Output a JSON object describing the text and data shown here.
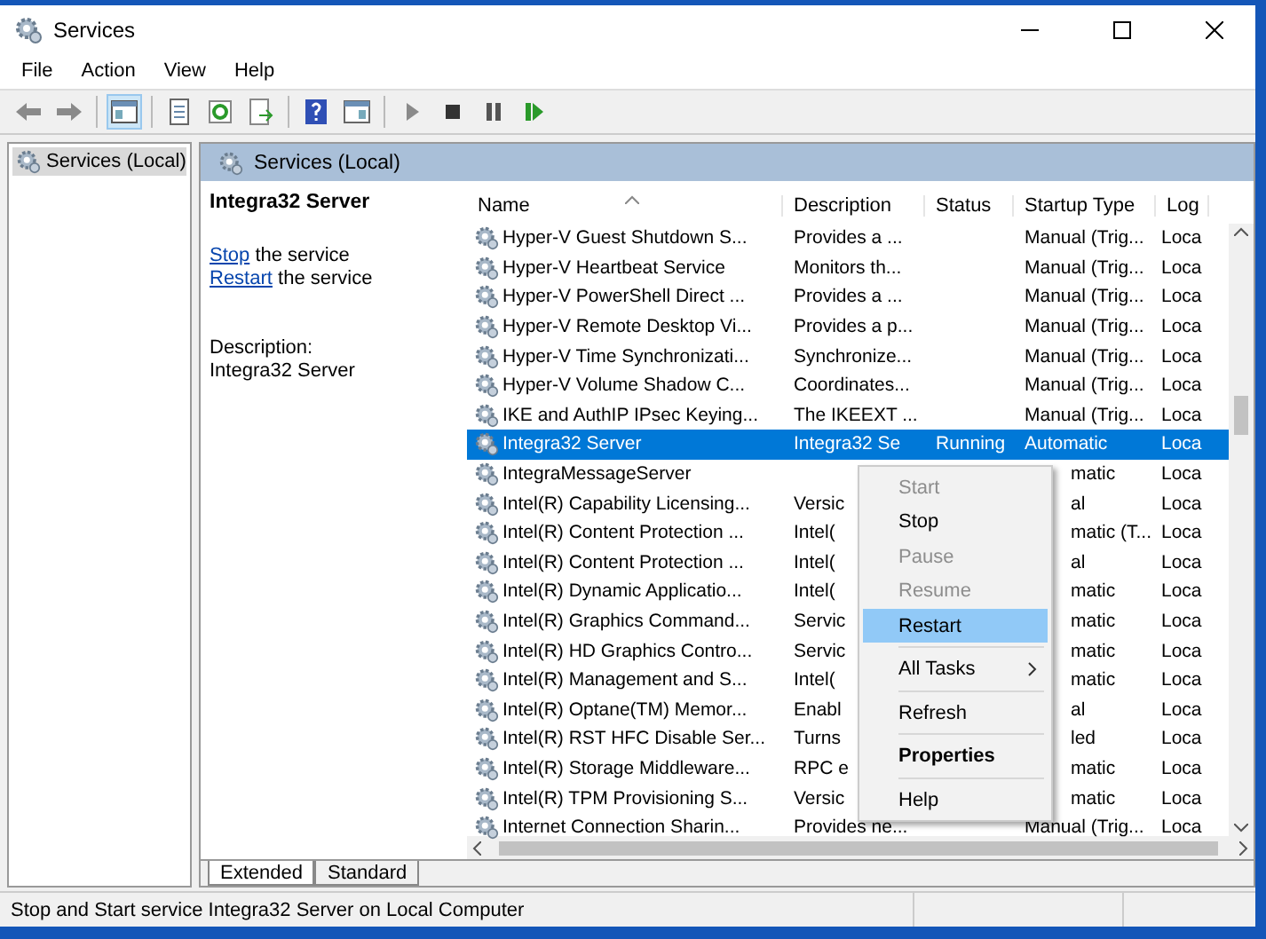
{
  "window": {
    "title": "Services"
  },
  "menu": [
    {
      "label": "File"
    },
    {
      "label": "Action"
    },
    {
      "label": "View"
    },
    {
      "label": "Help"
    }
  ],
  "tree": {
    "items": [
      {
        "label": "Services (Local)",
        "selected": true
      }
    ]
  },
  "pane_title": "Services (Local)",
  "extended": {
    "service_name": "Integra32 Server",
    "actions": [
      {
        "link": "Stop",
        "rest": "the service"
      },
      {
        "link": "Restart",
        "rest": "the service"
      }
    ],
    "description_label": "Description:",
    "description": "Integra32 Server"
  },
  "table": {
    "columns": [
      {
        "label": "Name",
        "sorted": true
      },
      {
        "label": "Description",
        "sorted": false
      },
      {
        "label": "Status",
        "sorted": false
      },
      {
        "label": "Startup Type",
        "sorted": false
      },
      {
        "label": "Log",
        "sorted": false
      }
    ],
    "rows": [
      {
        "name": "Hyper-V Guest Shutdown S...",
        "description": "Provides a ...",
        "status": "",
        "startup": "Manual (Trig...",
        "logon": "Loca",
        "selected": false,
        "covered": false
      },
      {
        "name": "Hyper-V Heartbeat Service",
        "description": "Monitors th...",
        "status": "",
        "startup": "Manual (Trig...",
        "logon": "Loca",
        "selected": false,
        "covered": false
      },
      {
        "name": "Hyper-V PowerShell Direct ...",
        "description": "Provides a ...",
        "status": "",
        "startup": "Manual (Trig...",
        "logon": "Loca",
        "selected": false,
        "covered": false
      },
      {
        "name": "Hyper-V Remote Desktop Vi...",
        "description": "Provides a p...",
        "status": "",
        "startup": "Manual (Trig...",
        "logon": "Loca",
        "selected": false,
        "covered": false
      },
      {
        "name": "Hyper-V Time Synchronizati...",
        "description": "Synchronize...",
        "status": "",
        "startup": "Manual (Trig...",
        "logon": "Loca",
        "selected": false,
        "covered": false
      },
      {
        "name": "Hyper-V Volume Shadow C...",
        "description": "Coordinates...",
        "status": "",
        "startup": "Manual (Trig...",
        "logon": "Loca",
        "selected": false,
        "covered": false
      },
      {
        "name": "IKE and AuthIP IPsec Keying...",
        "description": "The IKEEXT ...",
        "status": "",
        "startup": "Manual (Trig...",
        "logon": "Loca",
        "selected": false,
        "covered": false
      },
      {
        "name": "Integra32 Server",
        "description": "Integra32 Se",
        "status": "Running",
        "startup": "Automatic",
        "logon": "Loca",
        "selected": true,
        "covered": false
      },
      {
        "name": "IntegraMessageServer",
        "description": "",
        "status": "",
        "startup": "matic",
        "logon": "Loca",
        "selected": false,
        "covered": true
      },
      {
        "name": "Intel(R) Capability Licensing...",
        "description": "Versic",
        "status": "",
        "startup": "al",
        "logon": "Loca",
        "selected": false,
        "covered": true
      },
      {
        "name": "Intel(R) Content Protection ...",
        "description": "Intel(",
        "status": "",
        "startup": "matic (T...",
        "logon": "Loca",
        "selected": false,
        "covered": true
      },
      {
        "name": "Intel(R) Content Protection ...",
        "description": "Intel(",
        "status": "",
        "startup": "al",
        "logon": "Loca",
        "selected": false,
        "covered": true
      },
      {
        "name": "Intel(R) Dynamic Applicatio...",
        "description": "Intel(",
        "status": "",
        "startup": "matic",
        "logon": "Loca",
        "selected": false,
        "covered": true
      },
      {
        "name": "Intel(R) Graphics Command...",
        "description": "Servic",
        "status": "",
        "startup": "matic",
        "logon": "Loca",
        "selected": false,
        "covered": true
      },
      {
        "name": "Intel(R) HD Graphics Contro...",
        "description": "Servic",
        "status": "",
        "startup": "matic",
        "logon": "Loca",
        "selected": false,
        "covered": true
      },
      {
        "name": "Intel(R) Management and S...",
        "description": "Intel(",
        "status": "",
        "startup": "matic",
        "logon": "Loca",
        "selected": false,
        "covered": true
      },
      {
        "name": "Intel(R) Optane(TM) Memor...",
        "description": "Enabl",
        "status": "",
        "startup": "al",
        "logon": "Loca",
        "selected": false,
        "covered": true
      },
      {
        "name": "Intel(R) RST HFC Disable Ser...",
        "description": "Turns",
        "status": "",
        "startup": "led",
        "logon": "Loca",
        "selected": false,
        "covered": true
      },
      {
        "name": "Intel(R) Storage Middleware...",
        "description": "RPC e",
        "status": "",
        "startup": "matic",
        "logon": "Loca",
        "selected": false,
        "covered": true
      },
      {
        "name": "Intel(R) TPM Provisioning S...",
        "description": "Versic",
        "status": "",
        "startup": "matic",
        "logon": "Loca",
        "selected": false,
        "covered": true
      },
      {
        "name": "Internet Connection Sharin...",
        "description": "Provides ne...",
        "status": "",
        "startup": "Manual (Trig...",
        "logon": "Loca",
        "selected": false,
        "covered": false
      }
    ]
  },
  "context_menu": [
    {
      "kind": "item",
      "label": "Start",
      "disabled": true,
      "selected": false,
      "bold": false,
      "submenu": false
    },
    {
      "kind": "item",
      "label": "Stop",
      "disabled": false,
      "selected": false,
      "bold": false,
      "submenu": false
    },
    {
      "kind": "item",
      "label": "Pause",
      "disabled": true,
      "selected": false,
      "bold": false,
      "submenu": false
    },
    {
      "kind": "item",
      "label": "Resume",
      "disabled": true,
      "selected": false,
      "bold": false,
      "submenu": false
    },
    {
      "kind": "item",
      "label": "Restart",
      "disabled": false,
      "selected": true,
      "bold": false,
      "submenu": false
    },
    {
      "kind": "separator"
    },
    {
      "kind": "item",
      "label": "All Tasks",
      "disabled": false,
      "selected": false,
      "bold": false,
      "submenu": true
    },
    {
      "kind": "separator"
    },
    {
      "kind": "item",
      "label": "Refresh",
      "disabled": false,
      "selected": false,
      "bold": false,
      "submenu": false
    },
    {
      "kind": "separator"
    },
    {
      "kind": "item",
      "label": "Properties",
      "disabled": false,
      "selected": false,
      "bold": true,
      "submenu": false
    },
    {
      "kind": "separator"
    },
    {
      "kind": "item",
      "label": "Help",
      "disabled": false,
      "selected": false,
      "bold": false,
      "submenu": false
    }
  ],
  "view_tabs": [
    {
      "label": "Extended",
      "selected": true
    },
    {
      "label": "Standard",
      "selected": false
    }
  ],
  "status_bar": {
    "text": "Stop and Start service Integra32 Server on Local Computer"
  }
}
